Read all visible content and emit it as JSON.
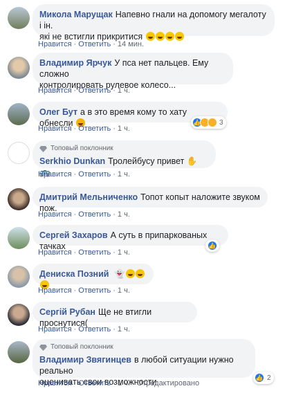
{
  "actions": {
    "like": "Нравится",
    "reply": "Ответить",
    "edited": "Отредактировано",
    "sep": "·"
  },
  "comments": [
    {
      "author": "Микола Марущак",
      "text": "Напевно гнали на допомогу мегалоту і ін.",
      "text2": "які не встигли прикритися",
      "time": "14 мин."
    },
    {
      "author": "Владимир Ярчук",
      "text": "У пса нет пальцев. Ему сложно",
      "text2": "контролировать рулевое колесо...",
      "time": "1 ч."
    },
    {
      "author": "Олег Бут",
      "text": "а в это время кому то хату обнесли",
      "time": "1 ч.",
      "reactions": "3"
    },
    {
      "badge": "Топовый поклонник",
      "author": "Serkhio Dunkan",
      "text": "Тролейбусу привет",
      "time": "1 ч."
    },
    {
      "author": "Дмитрий Мельниченко",
      "text": "Топот копыт наложите звуком пож.",
      "time": "1 ч."
    },
    {
      "author": "Сергей Захаров",
      "text": "А суть в припаркованых тачках",
      "time": "1 ч.",
      "reactions": ""
    },
    {
      "author": "Дениска Позний",
      "text": "",
      "time": "1 ч."
    },
    {
      "author": "Сергій Рубан",
      "text": "Ще не втигли проснутися(",
      "time": "1 ч."
    },
    {
      "badge": "Топовый поклонник",
      "author": "Владимир Звягинцев",
      "text": "в любой ситуации нужно реально",
      "text2": "оценивать свои возможности",
      "time": "1 ч.",
      "reactions": "2"
    }
  ],
  "colors": {
    "link": "#385898",
    "bubble": "#f2f3f5",
    "meta": "#606770",
    "like": "#1877f2"
  }
}
